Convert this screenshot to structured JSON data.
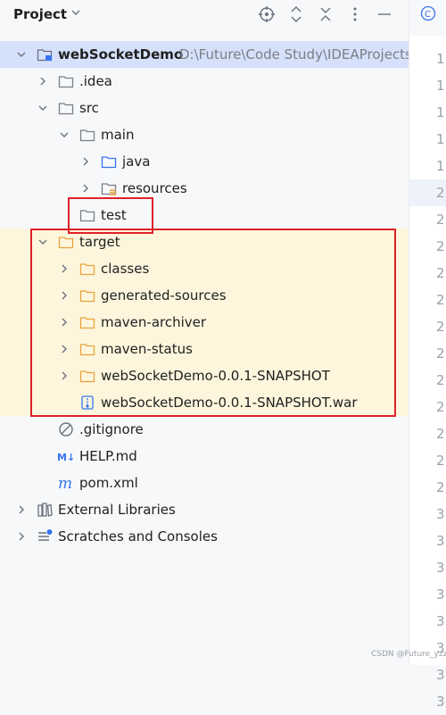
{
  "toolbar": {
    "title": "Project",
    "icons": [
      "target-icon",
      "expand-collapse-icon",
      "collapse-all-icon",
      "more-vertical-icon",
      "minimize-icon"
    ]
  },
  "tree": {
    "root": {
      "label": "webSocketDemo",
      "path": "D:\\Future\\Code Study\\IDEAProjects"
    },
    "idea": ".idea",
    "src": "src",
    "main": "main",
    "java": "java",
    "resources": "resources",
    "test": "test",
    "target": "target",
    "classes": "classes",
    "generated_sources": "generated-sources",
    "maven_archiver": "maven-archiver",
    "maven_status": "maven-status",
    "snapshot_dir": "webSocketDemo-0.0.1-SNAPSHOT",
    "snapshot_war": "webSocketDemo-0.0.1-SNAPSHOT.war",
    "gitignore": ".gitignore",
    "help": "HELP.md",
    "pom": "pom.xml",
    "external_libraries": "External Libraries",
    "scratches": "Scratches and Consoles"
  },
  "gutter": {
    "line_digits": [
      "1",
      "1",
      "1",
      "1",
      "1",
      "2",
      "2",
      "2",
      "2",
      "2",
      "2",
      "2",
      "2",
      "2",
      "2",
      "2",
      "2",
      "3",
      "3",
      "3",
      "3",
      "3",
      "3",
      "3",
      "3"
    ]
  },
  "watermark": "CSDN @Future_yzz",
  "colors": {
    "selection": "#d5e1fb",
    "highlight": "#fdf6dd",
    "annotation": "#e0202a",
    "folder": "#7a7e85",
    "excluded_folder": "#e8a33d",
    "source_folder": "#3574f0"
  }
}
